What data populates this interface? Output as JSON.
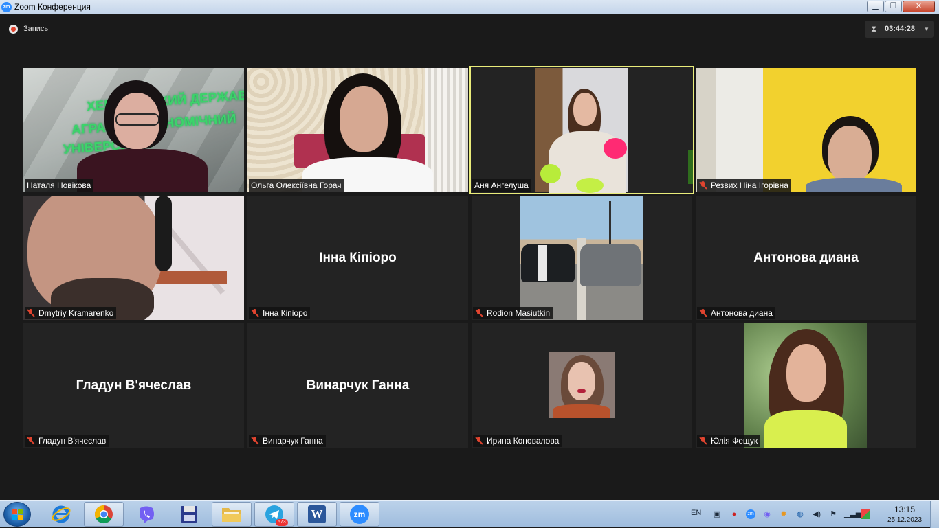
{
  "window": {
    "title": "Zoom Конференция",
    "app_icon_text": "zm",
    "minimize": "▁",
    "maximize": "❐",
    "close": "✕"
  },
  "meeting": {
    "recording_label": "Запись",
    "timer": "03:44:28",
    "timer_icon": "⧗",
    "timer_caret": "▼"
  },
  "watermark": {
    "line1": "ХЕРСОНСЬКИЙ ДЕРЖАВ",
    "line2": "АГРАРНО-ЕКОНОМІЧНИЙ",
    "line3": "УНІВЕРСИТЕТ"
  },
  "participants": [
    {
      "name": "Наталя Новікова",
      "muted": false,
      "video": true,
      "active": false
    },
    {
      "name": "Ольга Олексіївна Горач",
      "muted": false,
      "video": true,
      "active": false
    },
    {
      "name": "Аня Ангелуша",
      "muted": false,
      "video": true,
      "active": true
    },
    {
      "name": "Резвих Ніна Ігорівна",
      "muted": true,
      "video": true,
      "active": false
    },
    {
      "name": "Dmytriy Kramarenko",
      "muted": true,
      "video": true,
      "active": false
    },
    {
      "name": "Інна Кіпіоро",
      "muted": true,
      "video": false,
      "active": false
    },
    {
      "name": "Rodion Masiutkin",
      "muted": true,
      "video": true,
      "active": false
    },
    {
      "name": "Антонова диана",
      "muted": true,
      "video": false,
      "active": false
    },
    {
      "name": "Гладун В'ячеслав",
      "muted": true,
      "video": false,
      "active": false
    },
    {
      "name": "Винарчук Ганна",
      "muted": true,
      "video": false,
      "active": false
    },
    {
      "name": "Ирина Коновалова",
      "muted": true,
      "video": true,
      "active": false
    },
    {
      "name": "Юлія Фещук",
      "muted": true,
      "video": true,
      "active": false
    }
  ],
  "taskbar": {
    "apps": [
      "internet-explorer",
      "chrome",
      "viber",
      "save",
      "explorer",
      "telegram",
      "word",
      "zoom"
    ],
    "telegram_badge": "573",
    "zoom_label": "zm",
    "word_label": "W",
    "language": "EN",
    "clock_time": "13:15",
    "clock_date": "25.12.2023"
  },
  "colors": {
    "meeting_bg": "#1a1a1a",
    "tile_bg": "#232323",
    "active_speaker_border": "#e9ec7a",
    "mute_red": "#e0442f",
    "zoom_blue": "#2d8cff"
  }
}
